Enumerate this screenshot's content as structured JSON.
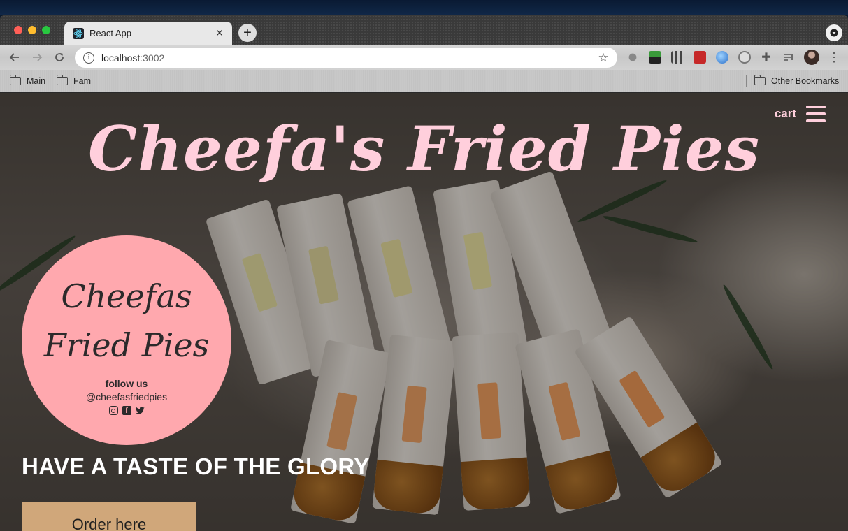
{
  "browser": {
    "tab": {
      "title": "React App",
      "favicon": "react-icon"
    },
    "address_bar": {
      "host": "localhost",
      "port": ":3002"
    },
    "bookmarks": [
      {
        "label": "Main"
      },
      {
        "label": "Fam"
      }
    ],
    "other_bookmarks_label": "Other Bookmarks"
  },
  "site": {
    "title": "Cheefa's Fried Pies",
    "cart_label": "cart",
    "logo": {
      "line1": "Cheefas",
      "line2": "Fried Pies",
      "follow_label": "follow us",
      "handle": "@cheefasfriedpies",
      "social_icons": [
        "instagram-icon",
        "facebook-icon",
        "twitter-icon"
      ]
    },
    "tagline": "HAVE A TASTE OF THE GLORY",
    "order_button_label": "Order here"
  },
  "colors": {
    "title_pink": "#ffcfdc",
    "logo_pink": "#ffa8ae",
    "order_button": "#d0a77a"
  }
}
